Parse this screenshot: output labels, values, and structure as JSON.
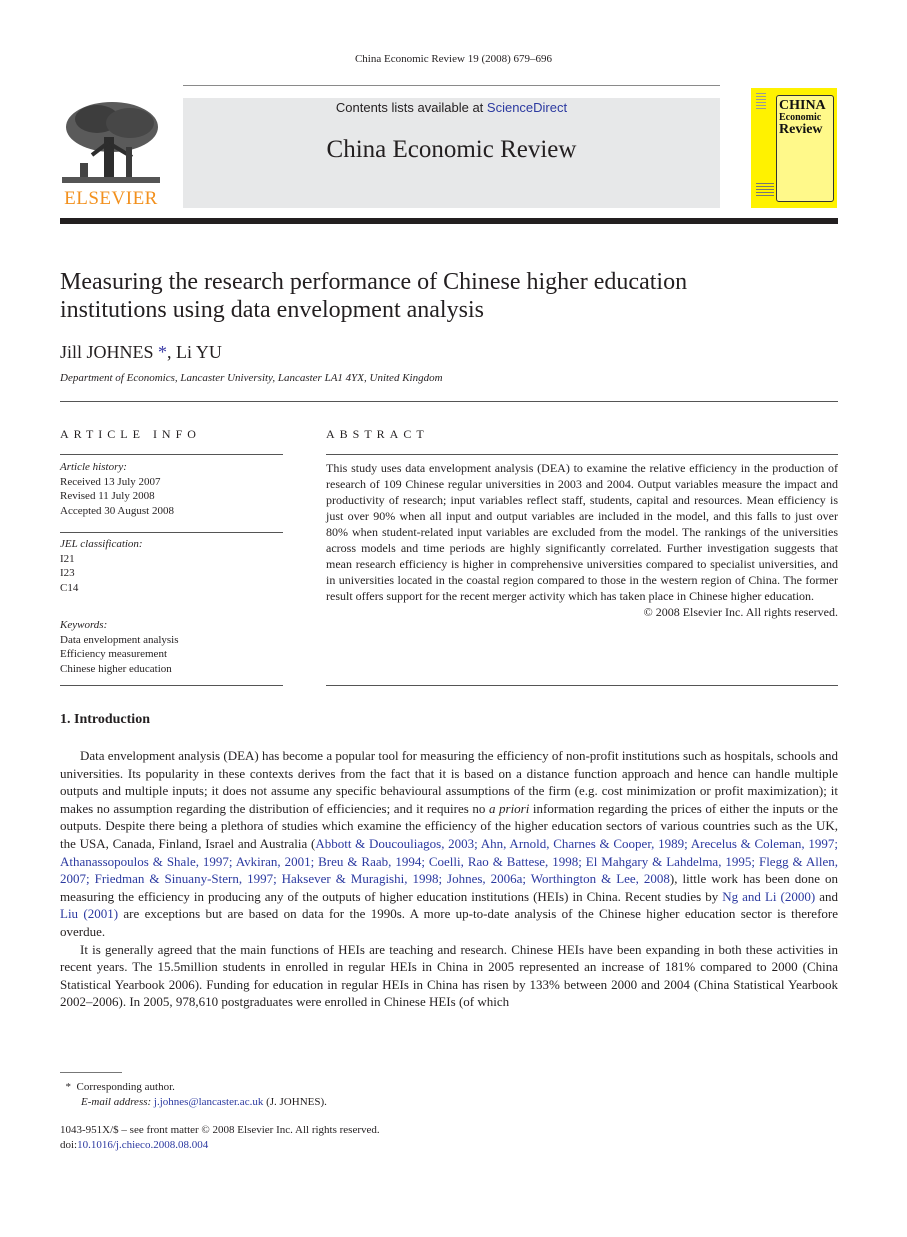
{
  "running_head": "China Economic Review 19 (2008) 679–696",
  "publisher": {
    "logo_icon": "elsevier-tree-logo",
    "name": "ELSEVIER",
    "brand_color": "#f2901d"
  },
  "banner": {
    "contents_prefix": "Contents lists available at ",
    "contents_link": "ScienceDirect",
    "journal_name": "China Economic Review",
    "background_color": "#e7e8e9",
    "link_color": "#2b39a0"
  },
  "cover": {
    "icon": "journal-cover-thumbnail",
    "title_line1": "CHINA",
    "title_line2": "Economic",
    "title_line3": "Review",
    "color": "#fff200"
  },
  "article": {
    "title_line1": "Measuring the research performance of Chinese higher education",
    "title_line2": "institutions using data envelopment analysis",
    "author1": "Jill JOHNES",
    "author_marker": "*",
    "author_sep": ", ",
    "author2": "Li YU",
    "affiliation": "Department of Economics, Lancaster University, Lancaster LA1 4YX, United Kingdom"
  },
  "article_info": {
    "heading": "ARTICLE INFO",
    "history_label": "Article history:",
    "history": [
      "Received 13 July 2007",
      "Revised 11 July 2008",
      "Accepted 30 August 2008"
    ],
    "jel_label": "JEL classification:",
    "jel": [
      "I21",
      "I23",
      "C14"
    ],
    "keywords_label": "Keywords:",
    "keywords": [
      "Data envelopment analysis",
      "Efficiency measurement",
      "Chinese higher education"
    ]
  },
  "abstract": {
    "heading": "ABSTRACT",
    "text": "This study uses data envelopment analysis (DEA) to examine the relative efficiency in the production of research of 109 Chinese regular universities in 2003 and 2004. Output variables measure the impact and productivity of research; input variables reflect staff, students, capital and resources. Mean efficiency is just over 90% when all input and output variables are included in the model, and this falls to just over 80% when student-related input variables are excluded from the model. The rankings of the universities across models and time periods are highly significantly correlated. Further investigation suggests that mean research efficiency is higher in comprehensive universities compared to specialist universities, and in universities located in the coastal region compared to those in the western region of China. The former result offers support for the recent merger activity which has taken place in Chinese higher education.",
    "copyright": "© 2008 Elsevier Inc. All rights reserved."
  },
  "introduction": {
    "heading": "1. Introduction",
    "p1_a": "Data envelopment analysis (DEA) has become a popular tool for measuring the efficiency of non-profit institutions such as hospitals, schools and universities. Its popularity in these contexts derives from the fact that it is based on a distance function approach and hence can handle multiple outputs and multiple inputs; it does not assume any specific behavioural assumptions of the firm (e.g. cost minimization or profit maximization); it makes no assumption regarding the distribution of efficiencies; and it requires no ",
    "p1_italic": "a priori",
    "p1_b": " information regarding the prices of either the inputs or the outputs. Despite there being a plethora of studies which examine the efficiency of the higher education sectors of various countries such as the UK, the USA, Canada, Finland, Israel and Australia (",
    "p1_refs": "Abbott & Doucouliagos, 2003; Ahn, Arnold, Charnes & Cooper, 1989; Arecelus & Coleman, 1997; Athanassopoulos & Shale, 1997; Avkiran, 2001; Breu & Raab, 1994; Coelli, Rao & Battese, 1998; El Mahgary & Lahdelma, 1995; Flegg & Allen, 2007; Friedman & Sinuany-Stern, 1997; Haksever & Muragishi, 1998; Johnes, 2006a; Worthington & Lee, 2008",
    "p1_c": "), little work has been done on measuring the efficiency in producing any of the outputs of higher education institutions (HEIs) in China. Recent studies by ",
    "p1_ref2": "Ng and Li (2000)",
    "p1_d": " and ",
    "p1_ref3": "Liu (2001)",
    "p1_e": " are exceptions but are based on data for the 1990s. A more up-to-date analysis of the Chinese higher education sector is therefore overdue.",
    "p2": "It is generally agreed that the main functions of HEIs are teaching and research. Chinese HEIs have been expanding in both these activities in recent years. The 15.5million students in enrolled in regular HEIs in China in 2005 represented an increase of 181% compared to 2000 (China Statistical Yearbook 2006). Funding for education in regular HEIs in China has risen by 133% between 2000 and 2004 (China Statistical Yearbook 2002–2006). In 2005, 978,610 postgraduates were enrolled in Chinese HEIs (of which"
  },
  "footnote": {
    "marker": "*",
    "corresponding": "Corresponding author.",
    "email_label": "E-mail address:",
    "email": "j.johnes@lancaster.ac.uk",
    "email_suffix": " (J. JOHNES)."
  },
  "front_matter": {
    "issn_line": "1043-951X/$ – see front matter © 2008 Elsevier Inc. All rights reserved.",
    "doi_label": "doi:",
    "doi": "10.1016/j.chieco.2008.08.004"
  }
}
